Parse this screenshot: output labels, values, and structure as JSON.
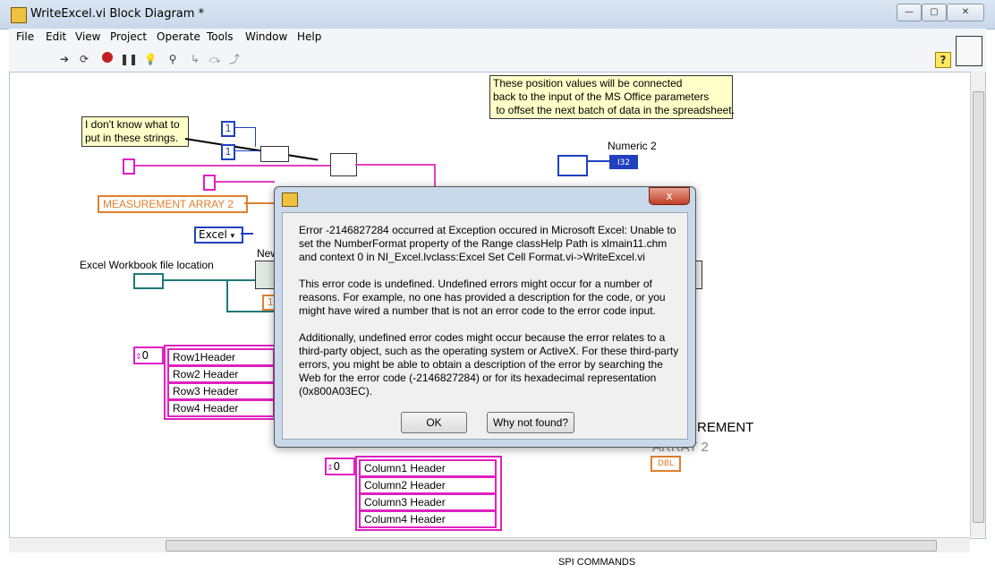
{
  "window": {
    "title": "WriteExcel.vi Block Diagram *",
    "controls": {
      "minimize": "—",
      "restore": "▢",
      "close": "✕"
    }
  },
  "menu": [
    "File",
    "Edit",
    "View",
    "Project",
    "Operate",
    "Tools",
    "Window",
    "Help"
  ],
  "toolbar": {
    "icons": [
      "run-arrow-icon",
      "run-continuous-icon",
      "abort-icon",
      "pause-icon",
      "highlight-execution-icon",
      "retain-wire-values-icon",
      "step-into-icon",
      "step-over-icon",
      "step-out-icon",
      "context-help-icon"
    ],
    "help_glyph": "?"
  },
  "diagram": {
    "note_strings": "I don't know what to\nput in these strings.",
    "note_position": "These position values will be connected\nback to the input of the MS Office parameters\n to offset the next batch of data in the spreadsheet.",
    "const_one_a": "1",
    "const_one_b": "1",
    "measurement_array": "MEASUREMENT  ARRAY 2",
    "excel_ring": "Excel",
    "workbook_label": "Excel Workbook file location",
    "new_label": "New",
    "numeric2_label": "Numeric 2",
    "numeric2_type": "I32",
    "row_index": "0",
    "row_headers": [
      "Row1Header",
      "Row2 Header",
      "Row3 Header",
      "Row4 Header"
    ],
    "col_index": "0",
    "col_headers": [
      "Column1 Header",
      "Column2 Header",
      "Column3 Header",
      "Column4 Header"
    ],
    "measurement_array_right": "REMENT",
    "measurement_array_right2": "ARRAY 2",
    "dbl_label": "DBL",
    "spi_label": "SPI COMMANDS",
    "small_const": "1."
  },
  "dialog": {
    "close": "x",
    "para1": "Error -2146827284 occurred at Exception occured in Microsoft Excel: Unable to set the NumberFormat property of the Range classHelp Path is xlmain11.chm and context 0 in NI_Excel.lvclass:Excel Set Cell Format.vi->WriteExcel.vi",
    "para2": "This error code is undefined. Undefined errors might occur for a number of reasons. For example, no one has provided a description for the code, or you might have wired a number that is not an error code to the error code input.",
    "para3": "Additionally, undefined error codes might occur because the error relates to a third-party object, such as the operating system or ActiveX. For these third-party errors, you might be able to obtain a description of the error by searching the Web for the error code (-2146827284) or for its hexadecimal representation (0x800A03EC).",
    "ok": "OK",
    "why": "Why not found?"
  }
}
